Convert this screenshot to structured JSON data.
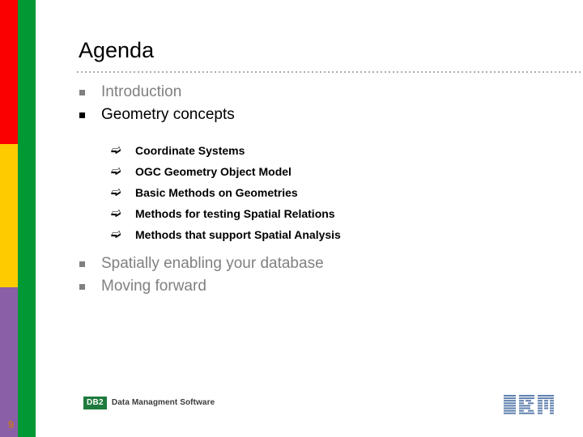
{
  "slide": {
    "title": "Agenda",
    "page_number": "9",
    "page_number_color": "#c1742e",
    "colors": {
      "bar_red": "#fa0000",
      "bar_yellow": "#fdcb00",
      "bar_purple": "#8a5fa8",
      "bar_green": "#009933",
      "text_black": "#000000",
      "text_grey": "#808080",
      "rule_grey": "#aeaeae",
      "db2_green": "#1f7a3d",
      "ibm_blue": "#5f7fae"
    }
  },
  "agenda": {
    "items": [
      {
        "label": "Introduction",
        "state": "inactive",
        "color": "#808080",
        "marker": "square-bullet",
        "sub_items": []
      },
      {
        "label": "Geometry concepts",
        "state": "active",
        "color": "#000000",
        "marker": "square-bullet",
        "sub_items": [
          {
            "label": "Coordinate Systems",
            "marker": "arrow-bullet"
          },
          {
            "label": "OGC Geometry Object Model",
            "marker": "arrow-bullet"
          },
          {
            "label": "Basic Methods on Geometries",
            "marker": "arrow-bullet"
          },
          {
            "label": "Methods for testing Spatial Relations",
            "marker": "arrow-bullet"
          },
          {
            "label": "Methods that support Spatial Analysis",
            "marker": "arrow-bullet"
          }
        ]
      },
      {
        "label": "Spatially enabling your database",
        "state": "inactive",
        "color": "#808080",
        "marker": "square-bullet",
        "sub_items": []
      },
      {
        "label": "Moving forward",
        "state": "inactive",
        "color": "#808080",
        "marker": "square-bullet",
        "sub_items": []
      }
    ]
  },
  "footer": {
    "db2_badge": "DB2",
    "db2_caption": "Data Managment Software",
    "brand": "IBM"
  }
}
